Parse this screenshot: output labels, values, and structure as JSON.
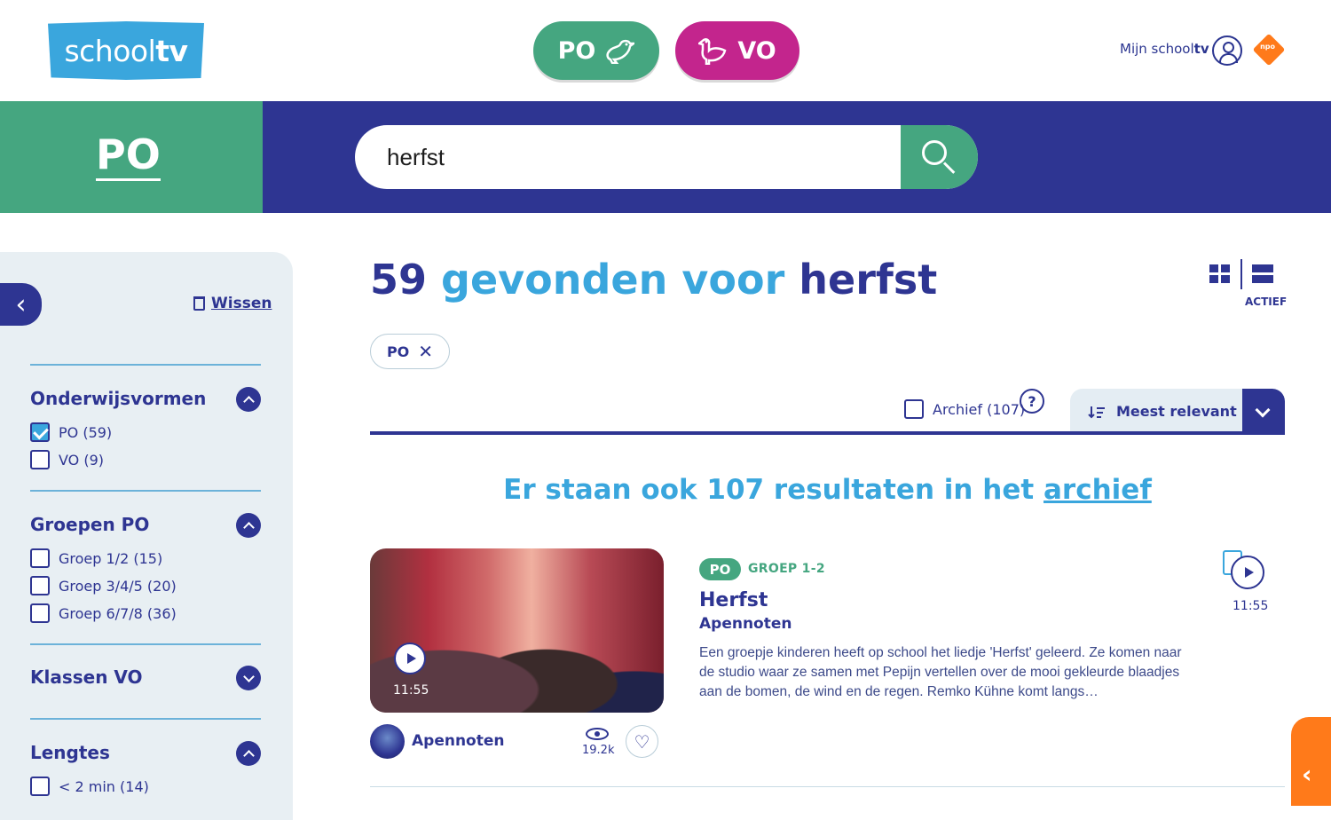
{
  "header": {
    "logo_text_a": "school",
    "logo_text_b": "tv",
    "pill_po": "PO",
    "pill_vo": "VO",
    "mijn_a": "Mijn school",
    "mijn_b": "tv",
    "npo": "npo"
  },
  "band": {
    "level": "PO",
    "search_value": "herfst"
  },
  "sidebar": {
    "wissen": "Wissen",
    "sections": {
      "onderwijsvormen": {
        "title": "Onderwijsvormen",
        "options": [
          "PO (59)",
          "VO (9)"
        ]
      },
      "groepen": {
        "title": "Groepen PO",
        "options": [
          "Groep 1/2 (15)",
          "Groep 3/4/5 (20)",
          "Groep 6/7/8 (36)"
        ]
      },
      "klassen": {
        "title": "Klassen VO"
      },
      "lengtes": {
        "title": "Lengtes",
        "options": [
          "< 2 min (14)"
        ]
      }
    }
  },
  "results": {
    "count": "59",
    "found_for": "gevonden voor",
    "query": "herfst",
    "view_actief": "ACTIEF",
    "chip": "PO",
    "chip_close": "✕",
    "archief_label": "Archief (107)",
    "help": "?",
    "sort_label": "Meest relevant",
    "archive_note_pre": "Er staan ook 107 resultaten in het ",
    "archive_note_link": "archief"
  },
  "item": {
    "duration": "11:55",
    "program": "Apennoten",
    "views": "19.2k",
    "badge": "PO",
    "groep": "GROEP 1-2",
    "title": "Herfst",
    "subtitle": "Apennoten",
    "description": "Een groepje kinderen heeft op school het liedje 'Herfst' geleerd. Ze komen naar de studio waar ze samen met Pepijn vertellen over de mooi gekleurde blaadjes aan de bomen, de wind en de regen. Remko Kühne komt langs…",
    "side_duration": "11:55"
  }
}
